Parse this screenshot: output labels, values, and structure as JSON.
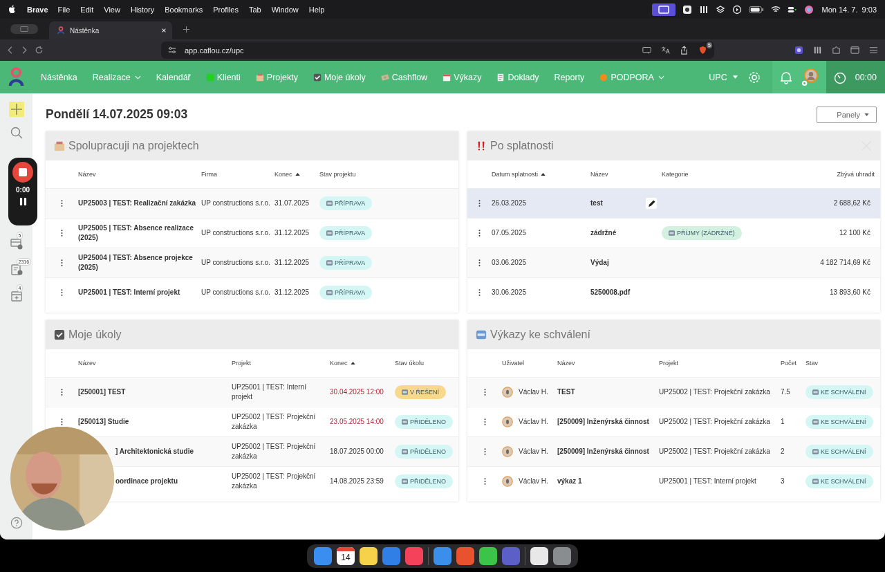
{
  "menubar": {
    "app": "Brave",
    "menus": [
      "File",
      "Edit",
      "View",
      "History",
      "Bookmarks",
      "Profiles",
      "Tab",
      "Window",
      "Help"
    ],
    "clock": "Mon 14. 7.  9:03"
  },
  "browser": {
    "tab_title": "Nástěnka",
    "url": "app.caflou.cz/upc",
    "shields_count": "5"
  },
  "nav": {
    "items": [
      {
        "label": "Nástěnka",
        "kind": "plain",
        "dropdown": false
      },
      {
        "label": "Realizace",
        "kind": "plain",
        "dropdown": true
      },
      {
        "label": "Kalendář",
        "kind": "plain",
        "dropdown": false
      },
      {
        "label": "Klienti",
        "kind": "clients",
        "dropdown": false
      },
      {
        "label": "Projekty",
        "kind": "projects",
        "dropdown": false
      },
      {
        "label": "Moje úkoly",
        "kind": "tasks",
        "dropdown": false
      },
      {
        "label": "Cashflow",
        "kind": "cashflow",
        "dropdown": false
      },
      {
        "label": "Výkazy",
        "kind": "timesheets",
        "dropdown": false
      },
      {
        "label": "Doklady",
        "kind": "documents",
        "dropdown": false
      },
      {
        "label": "Reporty",
        "kind": "plain",
        "dropdown": false
      },
      {
        "label": "PODPORA",
        "kind": "support",
        "dropdown": true
      }
    ],
    "company": "UPC",
    "timer": "00:00"
  },
  "sidebar": [
    {
      "kind": "add"
    },
    {
      "kind": "search"
    },
    {
      "kind": "cards",
      "badge": "5"
    },
    {
      "kind": "report",
      "badge": "2316"
    },
    {
      "kind": "calendar",
      "badge": "4"
    },
    {
      "kind": "help"
    }
  ],
  "recorder": {
    "time": "0:00"
  },
  "heading": "Pondělí 14.07.2025 09:03",
  "panels_button": "Panely",
  "panels": [
    {
      "kind": "projects",
      "title": "Spolupracuji na projektech",
      "closable": false,
      "columns": [
        {
          "label": "Název",
          "sorted": false
        },
        {
          "label": "Firma",
          "sorted": false
        },
        {
          "label": "Konec",
          "sorted": true
        },
        {
          "label": "Stav projektu",
          "sorted": false
        }
      ],
      "rows": [
        {
          "cells": [
            {
              "kind": "title",
              "text": "UP25003 | TEST: Realizační zakázka"
            },
            {
              "kind": "text",
              "text": "UP constructions s.r.o."
            },
            {
              "kind": "text",
              "text": "31.07.2025"
            },
            {
              "kind": "badge",
              "text": "PŘÍPRAVA",
              "color": "#d4f6f4"
            }
          ]
        },
        {
          "cells": [
            {
              "kind": "title",
              "text": "UP25005 | TEST: Absence realizace (2025)"
            },
            {
              "kind": "text",
              "text": "UP constructions s.r.o."
            },
            {
              "kind": "text",
              "text": "31.12.2025"
            },
            {
              "kind": "badge",
              "text": "PŘÍPRAVA",
              "color": "#d4f6f4"
            }
          ]
        },
        {
          "cells": [
            {
              "kind": "title",
              "text": "UP25004 | TEST: Absence projekce (2025)"
            },
            {
              "kind": "text",
              "text": "UP constructions s.r.o."
            },
            {
              "kind": "text",
              "text": "31.12.2025"
            },
            {
              "kind": "badge",
              "text": "PŘÍPRAVA",
              "color": "#d4f6f4"
            }
          ]
        },
        {
          "cells": [
            {
              "kind": "title",
              "text": "UP25001 | TEST: Interní projekt"
            },
            {
              "kind": "text",
              "text": "UP constructions s.r.o."
            },
            {
              "kind": "text",
              "text": "31.12.2025"
            },
            {
              "kind": "badge",
              "text": "PŘÍPRAVA",
              "color": "#d4f6f4"
            }
          ]
        }
      ]
    },
    {
      "kind": "overdue",
      "title": "Po splatnosti",
      "closable": true,
      "columns": [
        {
          "label": "Datum splatnosti",
          "sorted": true
        },
        {
          "label": "Název",
          "sorted": false
        },
        {
          "label": "Kategorie",
          "sorted": false
        },
        {
          "label": "Zbývá uhradit",
          "sorted": false
        }
      ],
      "rows": [
        {
          "selected": true,
          "cells": [
            {
              "kind": "text",
              "text": "26.03.2025"
            },
            {
              "kind": "title",
              "text": "test"
            },
            {
              "kind": "empty"
            },
            {
              "kind": "amount",
              "text": "2 688,62 Kč"
            }
          ]
        },
        {
          "selected": false,
          "cells": [
            {
              "kind": "text",
              "text": "07.05.2025"
            },
            {
              "kind": "title",
              "text": "zádržné"
            },
            {
              "kind": "badge",
              "text": "PŘÍJMY (ZÁDRŽNÉ)",
              "color": "#d3f0e1"
            },
            {
              "kind": "amount",
              "text": "12 100 Kč"
            }
          ]
        },
        {
          "selected": false,
          "cells": [
            {
              "kind": "text",
              "text": "03.06.2025"
            },
            {
              "kind": "title",
              "text": "Výdaj"
            },
            {
              "kind": "empty"
            },
            {
              "kind": "amount",
              "text": "4 182 714,69 Kč"
            }
          ]
        },
        {
          "selected": false,
          "cells": [
            {
              "kind": "text",
              "text": "30.06.2025"
            },
            {
              "kind": "title",
              "text": "5250008.pdf"
            },
            {
              "kind": "empty"
            },
            {
              "kind": "amount",
              "text": "13 893,60 Kč"
            }
          ]
        }
      ]
    },
    {
      "kind": "tasks",
      "title": "Moje úkoly",
      "closable": false,
      "columns": [
        {
          "label": "Název",
          "sorted": false
        },
        {
          "label": "Projekt",
          "sorted": false
        },
        {
          "label": "Konec",
          "sorted": true
        },
        {
          "label": "Stav úkolu",
          "sorted": false
        }
      ],
      "rows": [
        {
          "cells": [
            {
              "kind": "title",
              "text": "[250001] TEST"
            },
            {
              "kind": "text",
              "text": "UP25001 | TEST: Interní projekt"
            },
            {
              "kind": "date",
              "text": "30.04.2025 12:00",
              "overdue": true
            },
            {
              "kind": "badge",
              "text": "V ŘEŠENÍ",
              "color": "#f8d88a"
            }
          ]
        },
        {
          "cells": [
            {
              "kind": "title",
              "text": "[250013] Studie"
            },
            {
              "kind": "text",
              "text": "UP25002 | TEST: Projekční zakázka"
            },
            {
              "kind": "date",
              "text": "23.05.2025 14:00",
              "overdue": true
            },
            {
              "kind": "badge",
              "text": "PŘIDĚLENO",
              "color": "#d4f6f4"
            }
          ]
        },
        {
          "cells": [
            {
              "kind": "covered_title",
              "text": "] Architektonická studie"
            },
            {
              "kind": "text",
              "text": "UP25002 | TEST: Projekční zakázka"
            },
            {
              "kind": "date",
              "text": "18.07.2025 00:00",
              "overdue": false
            },
            {
              "kind": "badge",
              "text": "PŘIDĚLENO",
              "color": "#d4f6f4"
            }
          ]
        },
        {
          "cells": [
            {
              "kind": "covered_title",
              "text": "oordinace projektu"
            },
            {
              "kind": "text",
              "text": "UP25002 | TEST: Projekční zakázka"
            },
            {
              "kind": "date",
              "text": "14.08.2025 23:59",
              "overdue": false
            },
            {
              "kind": "badge",
              "text": "PŘIDĚLENO",
              "color": "#d4f6f4"
            }
          ]
        }
      ]
    },
    {
      "kind": "reports",
      "title": "Výkazy ke schválení",
      "closable": false,
      "columns": [
        {
          "label": "Uživatel",
          "sorted": false
        },
        {
          "label": "Název",
          "sorted": false
        },
        {
          "label": "Projekt",
          "sorted": false
        },
        {
          "label": "Počet",
          "sorted": false
        },
        {
          "label": "Stav",
          "sorted": false
        }
      ],
      "rows": [
        {
          "cells": [
            {
              "kind": "user",
              "text": "Václav H."
            },
            {
              "kind": "title",
              "text": "TEST"
            },
            {
              "kind": "text",
              "text": "UP25002 | TEST: Projekční zakázka"
            },
            {
              "kind": "text",
              "text": "7.5"
            },
            {
              "kind": "badge",
              "text": "KE SCHVÁLENÍ",
              "color": "#d4f6f4"
            }
          ]
        },
        {
          "cells": [
            {
              "kind": "user",
              "text": "Václav H."
            },
            {
              "kind": "title",
              "text": "[250009] Inženýrská činnost"
            },
            {
              "kind": "text",
              "text": "UP25002 | TEST: Projekční zakázka"
            },
            {
              "kind": "text",
              "text": "1"
            },
            {
              "kind": "badge",
              "text": "KE SCHVÁLENÍ",
              "color": "#d4f6f4"
            }
          ]
        },
        {
          "cells": [
            {
              "kind": "user",
              "text": "Václav H."
            },
            {
              "kind": "title",
              "text": "[250009] Inženýrská činnost"
            },
            {
              "kind": "text",
              "text": "UP25002 | TEST: Projekční zakázka"
            },
            {
              "kind": "text",
              "text": "2"
            },
            {
              "kind": "badge",
              "text": "KE SCHVÁLENÍ",
              "color": "#d4f6f4"
            }
          ]
        },
        {
          "cells": [
            {
              "kind": "user",
              "text": "Václav H."
            },
            {
              "kind": "title",
              "text": "výkaz 1"
            },
            {
              "kind": "text",
              "text": "UP25001 | TEST: Interní projekt"
            },
            {
              "kind": "text",
              "text": "3"
            },
            {
              "kind": "badge",
              "text": "KE SCHVÁLENÍ",
              "color": "#d4f6f4"
            }
          ]
        }
      ]
    }
  ],
  "dock": [
    {
      "kind": "app",
      "color": "#3a8ef0"
    },
    {
      "kind": "calendar",
      "day": "14"
    },
    {
      "kind": "app",
      "color": "#f5d24a"
    },
    {
      "kind": "app",
      "color": "#2f7fe6"
    },
    {
      "kind": "app",
      "color": "#f3425a"
    },
    {
      "kind": "separator"
    },
    {
      "kind": "app",
      "color": "#3b8eea"
    },
    {
      "kind": "app",
      "color": "#e9522e"
    },
    {
      "kind": "app",
      "color": "#3cc448"
    },
    {
      "kind": "app",
      "color": "#5b5fc7"
    },
    {
      "kind": "separator"
    },
    {
      "kind": "app",
      "color": "#e8e8e8"
    },
    {
      "kind": "app",
      "color": "#8a8d90"
    }
  ]
}
